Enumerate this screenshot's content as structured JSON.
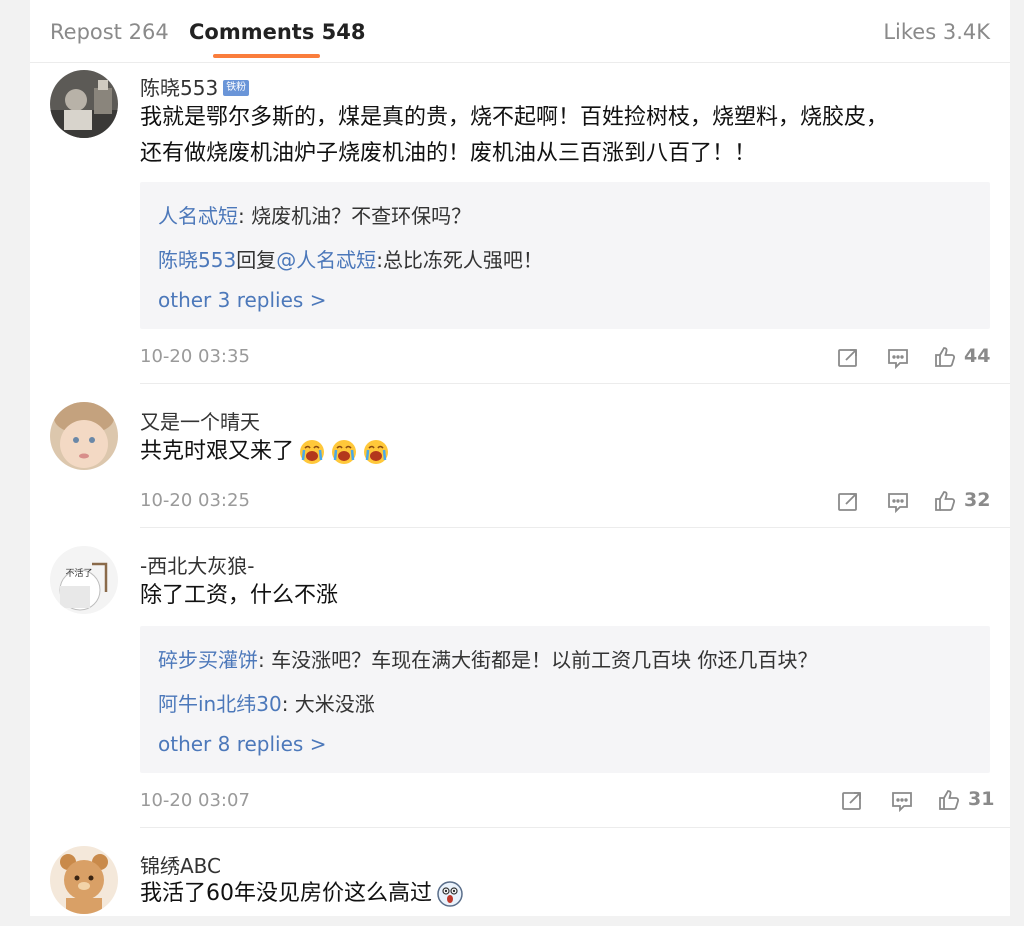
{
  "tabs": {
    "repost": "Repost 264",
    "comments": "Comments 548",
    "likes": "Likes 3.4K"
  },
  "comments": [
    {
      "username": "陈晓553",
      "badge": "铁粉",
      "text_line1": "我就是鄂尔多斯的，煤是真的贵，烧不起啊！百姓捡树枝，烧塑料，烧胶皮，",
      "text_line2": "还有做烧废机油炉子烧废机油的！废机油从三百涨到八百了！！",
      "replies": [
        {
          "user": "人名忒短",
          "sep": ": ",
          "text": "烧废机油？不查环保吗？"
        },
        {
          "user": "陈晓553",
          "mid": "回复",
          "mention": "@人名忒短",
          "sep": ":",
          "text": "总比冻死人强吧！"
        }
      ],
      "more_replies": "other 3 replies >",
      "time": "10-20 03:35",
      "likes": "44"
    },
    {
      "username": "又是一个晴天",
      "text_line1": "共克时艰又来了",
      "emoji": [
        "crying-emoji",
        "crying-emoji",
        "crying-emoji"
      ],
      "time": "10-20 03:25",
      "likes": "32"
    },
    {
      "username": "-西北大灰狼-",
      "avatar_caption": "不活了",
      "text_line1": "除了工资，什么不涨",
      "replies": [
        {
          "user": "碎步买灌饼",
          "sep": ": ",
          "text": "车没涨吧？车现在满大街都是！以前工资几百块 你还几百块？"
        },
        {
          "user": "阿牛in北纬30",
          "sep": ": ",
          "text": "大米没涨"
        }
      ],
      "more_replies": "other 8 replies >",
      "time": "10-20 03:07",
      "likes": "31"
    },
    {
      "username": "锦绣ABC",
      "text_line1": "我活了60年没见房价这么高过",
      "emoji": [
        "shocked-emoji"
      ]
    }
  ],
  "colors": {
    "accent": "#fa7d3c",
    "link": "#4c78ba",
    "muted": "#9a9a9a"
  }
}
